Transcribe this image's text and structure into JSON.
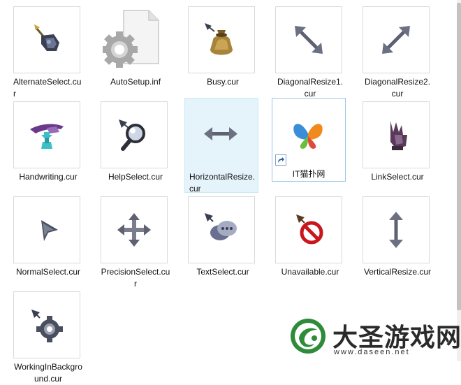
{
  "files": [
    {
      "name": "AlternateSelect.cur",
      "icon": "alternate-select-cursor-icon"
    },
    {
      "name": "AutoSetup.inf",
      "icon": "settings-file-icon"
    },
    {
      "name": "Busy.cur",
      "icon": "busy-sack-cursor-icon"
    },
    {
      "name": "DiagonalResize1.cur",
      "icon": "diagonal-resize-1-cursor-icon"
    },
    {
      "name": "DiagonalResize2.cur",
      "icon": "diagonal-resize-2-cursor-icon"
    },
    {
      "name": "Handwriting.cur",
      "icon": "handwriting-cursor-icon"
    },
    {
      "name": "HelpSelect.cur",
      "icon": "help-magnifier-cursor-icon"
    },
    {
      "name": "HorizontalResize.cur",
      "icon": "horizontal-resize-cursor-icon"
    },
    {
      "name": "IT猫扑网",
      "icon": "butterfly-shortcut-icon"
    },
    {
      "name": "LinkSelect.cur",
      "icon": "link-glove-cursor-icon"
    },
    {
      "name": "NormalSelect.cur",
      "icon": "normal-arrow-cursor-icon"
    },
    {
      "name": "PrecisionSelect.cur",
      "icon": "precision-move-cursor-icon"
    },
    {
      "name": "TextSelect.cur",
      "icon": "text-chat-cursor-icon"
    },
    {
      "name": "Unavailable.cur",
      "icon": "unavailable-cursor-icon"
    },
    {
      "name": "VerticalResize.cur",
      "icon": "vertical-resize-cursor-icon"
    },
    {
      "name": "WorkingInBackground.cur",
      "icon": "working-gear-cursor-icon"
    }
  ],
  "watermark": {
    "title": "大圣游戏网",
    "url": "www.daseen.net"
  },
  "colors": {
    "selection_background": "#e5f3fb",
    "selection_border": "#cde8f7",
    "watermark_green": "#2e8b3a"
  }
}
